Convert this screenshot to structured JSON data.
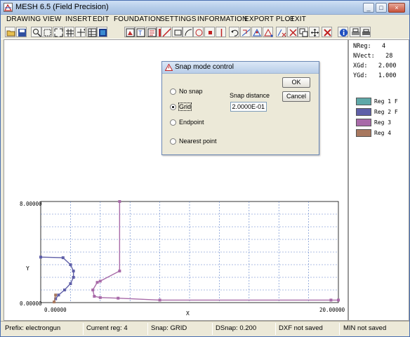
{
  "window": {
    "title": "MESH 6.5 (Field Precision)",
    "controls": {
      "minimize": "_",
      "maximize": "□",
      "close": "×"
    }
  },
  "menu": [
    "DRAWING",
    "VIEW",
    "INSERT",
    "EDIT",
    "FOUNDATION",
    "SETTINGS",
    "INFORMATION",
    "EXPORT PLOT",
    "EXIT"
  ],
  "toolbar": {
    "icons": [
      "folder-open-icon",
      "save-icon",
      "zoom-icon",
      "zoom-window-icon",
      "zoom-fit-icon",
      "grid-icon",
      "pan-icon",
      "table-icon",
      "color-fill-icon",
      "region-icon",
      "edit-text-icon",
      "region-properties-icon",
      "color-palette-icon",
      "line-tool-icon",
      "rectangle-tool-icon",
      "arc-tool-icon",
      "circle-tool-icon",
      "point-tool-icon",
      "vertical-line-icon",
      "undo-icon",
      "measure-icon",
      "snap-icon",
      "node-edit-icon",
      "node-delete-icon",
      "cut-icon",
      "copy-icon",
      "move-icon",
      "delete-icon",
      "info-icon",
      "print-icon",
      "print-setup-icon"
    ]
  },
  "side_panel": {
    "nreg_label": "NReg:",
    "nreg_value": "4",
    "nvect_label": "NVect:",
    "nvect_value": "28",
    "xgd_label": "XGd:",
    "xgd_value": "2.000",
    "ygd_label": "YGd:",
    "ygd_value": "1.000",
    "legend": [
      {
        "label": "Reg   1 F",
        "color": "#5fa8a8"
      },
      {
        "label": "Reg   2 F",
        "color": "#5f5fa8"
      },
      {
        "label": "Reg   3",
        "color": "#a86aa8"
      },
      {
        "label": "Reg   4",
        "color": "#a8785f"
      }
    ]
  },
  "plot": {
    "y_max_label": "8.00000",
    "y_min_label": "0.00000",
    "x_min_label": "0.00000",
    "x_max_label": "20.00000",
    "xlabel": "X",
    "ylabel": "Y",
    "xlim": [
      0,
      20
    ],
    "ylim": [
      0,
      8
    ],
    "grid_dx": 2,
    "grid_dy": 1,
    "regions": [
      {
        "name": "Reg 1",
        "color": "#5fa8a8",
        "points": []
      },
      {
        "name": "Reg 2",
        "color": "#5f5fa8",
        "points": [
          [
            0,
            3.6
          ],
          [
            1.5,
            3.55
          ],
          [
            2.0,
            3.0
          ],
          [
            2.2,
            2.5
          ],
          [
            2.2,
            2.0
          ],
          [
            2.0,
            1.5
          ],
          [
            1.6,
            1.0
          ],
          [
            1.2,
            0.6
          ],
          [
            1.0,
            0.3
          ]
        ]
      },
      {
        "name": "Reg 3",
        "color": "#a86aa8",
        "points": [
          [
            5.3,
            8.0
          ],
          [
            5.3,
            2.5
          ],
          [
            4.0,
            1.7
          ],
          [
            3.8,
            1.6
          ],
          [
            3.5,
            1.0
          ],
          [
            3.6,
            0.5
          ],
          [
            4.0,
            0.4
          ],
          [
            5.2,
            0.35
          ],
          [
            8.0,
            0.2
          ],
          [
            19.5,
            0.2
          ],
          [
            20.0,
            0.2
          ]
        ]
      },
      {
        "name": "Reg 4",
        "color": "#a8785f",
        "points": [
          [
            0.9,
            0.05
          ],
          [
            1.0,
            0.6
          ]
        ]
      }
    ]
  },
  "dialog": {
    "title": "Snap mode control",
    "options": [
      {
        "label": "No snap",
        "selected": false
      },
      {
        "label": "Grid",
        "selected": true
      },
      {
        "label": "Endpoint",
        "selected": false
      },
      {
        "label": "Nearest point",
        "selected": false
      }
    ],
    "snap_distance_label": "Snap distance",
    "snap_distance_value": "2.0000E-01",
    "ok_label": "OK",
    "cancel_label": "Cancel"
  },
  "status": {
    "prefix": "Prefix: electrongun",
    "current_reg": "Current reg:   4",
    "snap": "Snap: GRID",
    "dsnap": "DSnap:    0.200",
    "dxf": "DXF not saved",
    "min": "MIN not saved"
  }
}
